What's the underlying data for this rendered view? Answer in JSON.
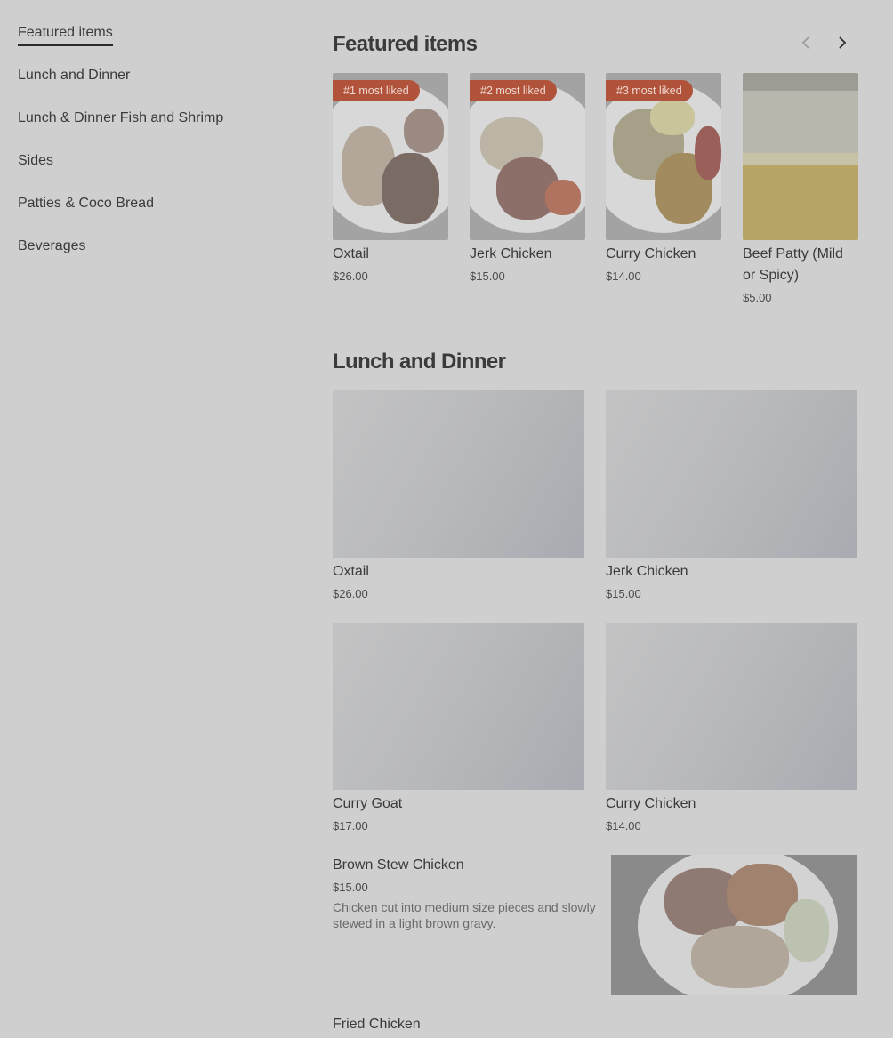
{
  "nav": {
    "items": [
      {
        "label": "Featured items",
        "active": true
      },
      {
        "label": "Lunch and Dinner"
      },
      {
        "label": "Lunch & Dinner Fish and Shrimp"
      },
      {
        "label": "Sides"
      },
      {
        "label": "Patties & Coco Bread"
      },
      {
        "label": "Beverages"
      }
    ]
  },
  "featured": {
    "title": "Featured items",
    "prev_icon": "chevron-left-icon",
    "next_icon": "chevron-right-icon",
    "cards": [
      {
        "badge": "#1 most liked",
        "name": "Oxtail",
        "price": "$26.00"
      },
      {
        "badge": "#2 most liked",
        "name": "Jerk Chicken",
        "price": "$15.00"
      },
      {
        "badge": "#3 most liked",
        "name": "Curry Chicken",
        "price": "$14.00"
      },
      {
        "badge": "",
        "name": "Beef Patty (Mild or Spicy)",
        "price": "$5.00"
      }
    ]
  },
  "lunch": {
    "title": "Lunch and Dinner",
    "cards": [
      {
        "name": "Oxtail",
        "price": "$26.00"
      },
      {
        "name": "Jerk Chicken",
        "price": "$15.00"
      },
      {
        "name": "Curry Goat",
        "price": "$17.00"
      },
      {
        "name": "Curry Chicken",
        "price": "$14.00"
      }
    ],
    "row_item": {
      "name": "Brown Stew Chicken",
      "price": "$15.00",
      "description": "Chicken cut into medium size pieces and slowly stewed in a light brown gravy."
    },
    "next_item": {
      "name": "Fried Chicken"
    }
  },
  "colors": {
    "badge": "#b0533a",
    "overlay": "#cfcfcf"
  }
}
